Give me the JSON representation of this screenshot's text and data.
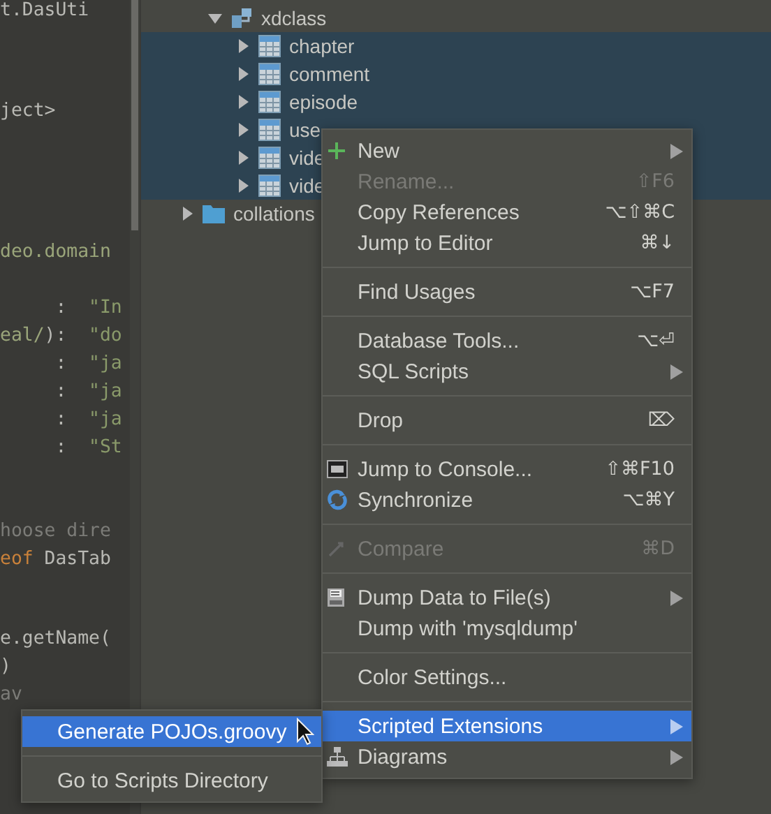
{
  "editor": {
    "blocks": [
      {
        "lines": [
          [
            {
              "kind": "plain",
              "text": "t.DasUti"
            }
          ]
        ]
      },
      {
        "lines": [
          [
            {
              "kind": "plain",
              "text": "ject>"
            }
          ]
        ]
      },
      {
        "lines": [
          [
            {
              "kind": "package",
              "text": "deo.domain"
            }
          ]
        ]
      },
      {
        "lines": [
          [
            {
              "kind": "plain",
              "text": "     :  "
            },
            {
              "kind": "string",
              "text": "\"In"
            }
          ],
          [
            {
              "kind": "package",
              "text": "eal/"
            },
            {
              "kind": "plain",
              "text": "):  "
            },
            {
              "kind": "string",
              "text": "\"do"
            }
          ],
          [
            {
              "kind": "plain",
              "text": "     :  "
            },
            {
              "kind": "string",
              "text": "\"ja"
            }
          ],
          [
            {
              "kind": "plain",
              "text": "     :  "
            },
            {
              "kind": "string",
              "text": "\"ja"
            }
          ],
          [
            {
              "kind": "plain",
              "text": "     :  "
            },
            {
              "kind": "string",
              "text": "\"ja"
            }
          ],
          [
            {
              "kind": "plain",
              "text": "     :  "
            },
            {
              "kind": "string",
              "text": "\"St"
            }
          ]
        ]
      },
      {
        "lines": [
          [
            {
              "kind": "comment",
              "text": "hoose dire"
            }
          ],
          [
            {
              "kind": "keyword",
              "text": "eof"
            },
            {
              "kind": "plain",
              "text": " DasTab"
            }
          ]
        ]
      },
      {
        "lines": [
          [
            {
              "kind": "plain",
              "text": "e.getName("
            }
          ],
          [
            {
              "kind": "plain",
              "text": ")"
            }
          ],
          [
            {
              "kind": "comment",
              "text": "av"
            }
          ]
        ]
      }
    ]
  },
  "database_tree": {
    "nodes": [
      {
        "kind": "schema",
        "name": "xdclass",
        "expanded": true,
        "selected": false,
        "children": [
          {
            "kind": "table",
            "name": "chapter",
            "expanded": false,
            "selected": true
          },
          {
            "kind": "table",
            "name": "comment",
            "expanded": false,
            "selected": true
          },
          {
            "kind": "table",
            "name": "episode",
            "expanded": false,
            "selected": true
          },
          {
            "kind": "table",
            "name": "use",
            "expanded": false,
            "selected": true
          },
          {
            "kind": "table",
            "name": "vide",
            "expanded": false,
            "selected": true
          },
          {
            "kind": "table",
            "name": "vide",
            "expanded": false,
            "selected": true
          }
        ]
      },
      {
        "kind": "folder",
        "name": "collations",
        "expanded": false,
        "selected": false
      }
    ]
  },
  "context_menu": {
    "groups": [
      [
        {
          "label": "New",
          "kind": "add",
          "submenu": true,
          "disabled": false,
          "selected": false
        },
        {
          "label": "Rename...",
          "shortcut": "⇧F6",
          "submenu": false,
          "disabled": true,
          "selected": false
        },
        {
          "label": "Copy References",
          "shortcut": "⌥⇧⌘C",
          "submenu": false,
          "disabled": false,
          "selected": false
        },
        {
          "label": "Jump to Editor",
          "shortcut": "⌘↓",
          "submenu": false,
          "disabled": false,
          "selected": false
        }
      ],
      [
        {
          "label": "Find Usages",
          "shortcut": "⌥F7",
          "submenu": false,
          "disabled": false,
          "selected": false
        }
      ],
      [
        {
          "label": "Database Tools...",
          "shortcut": "⌥⏎",
          "submenu": false,
          "disabled": false,
          "selected": false
        },
        {
          "label": "SQL Scripts",
          "submenu": true,
          "disabled": false,
          "selected": false
        }
      ],
      [
        {
          "label": "Drop",
          "shortcut": "⌦",
          "submenu": false,
          "disabled": false,
          "selected": false
        }
      ],
      [
        {
          "label": "Jump to Console...",
          "kind": "console",
          "shortcut": "⇧⌘F10",
          "submenu": false,
          "disabled": false,
          "selected": false
        },
        {
          "label": "Synchronize",
          "kind": "sync",
          "shortcut": "⌥⌘Y",
          "submenu": false,
          "disabled": false,
          "selected": false
        }
      ],
      [
        {
          "label": "Compare",
          "kind": "compare",
          "shortcut": "⌘D",
          "submenu": false,
          "disabled": true,
          "selected": false
        }
      ],
      [
        {
          "label": "Dump Data to File(s)",
          "kind": "dump",
          "submenu": true,
          "disabled": false,
          "selected": false
        },
        {
          "label": "Dump with 'mysqldump'",
          "submenu": false,
          "disabled": false,
          "selected": false
        }
      ],
      [
        {
          "label": "Color Settings...",
          "submenu": false,
          "disabled": false,
          "selected": false
        }
      ],
      [
        {
          "label": "Scripted Extensions",
          "submenu": true,
          "disabled": false,
          "selected": true
        },
        {
          "label": "Diagrams",
          "kind": "diagram",
          "submenu": true,
          "disabled": false,
          "selected": false
        }
      ]
    ]
  },
  "submenu": {
    "groups": [
      [
        {
          "label": "Generate POJOs.groovy",
          "selected": true
        }
      ],
      [
        {
          "label": "Go to Scripts Directory",
          "selected": false
        }
      ]
    ]
  }
}
